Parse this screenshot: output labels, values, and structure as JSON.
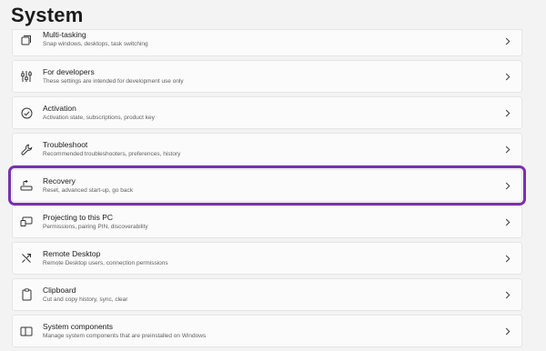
{
  "page": {
    "title": "System"
  },
  "items": [
    {
      "key": "multitasking",
      "title": "Multi-tasking",
      "desc": "Snap windows, desktops, task switching",
      "icon": "multitasking-icon"
    },
    {
      "key": "developers",
      "title": "For developers",
      "desc": "These settings are intended for development use only",
      "icon": "developer-tools-icon"
    },
    {
      "key": "activation",
      "title": "Activation",
      "desc": "Activation state, subscriptions, product key",
      "icon": "activation-check-icon"
    },
    {
      "key": "troubleshoot",
      "title": "Troubleshoot",
      "desc": "Recommended troubleshooters, preferences, history",
      "icon": "wrench-icon"
    },
    {
      "key": "recovery",
      "title": "Recovery",
      "desc": "Reset, advanced start-up, go back",
      "icon": "recovery-icon"
    },
    {
      "key": "projecting",
      "title": "Projecting to this PC",
      "desc": "Permissions, pairing PIN, discoverability",
      "icon": "projecting-icon"
    },
    {
      "key": "remote-desktop",
      "title": "Remote Desktop",
      "desc": "Remote Desktop users, connection permissions",
      "icon": "remote-desktop-icon"
    },
    {
      "key": "clipboard",
      "title": "Clipboard",
      "desc": "Cut and copy history, sync, clear",
      "icon": "clipboard-icon"
    },
    {
      "key": "system-components",
      "title": "System components",
      "desc": "Manage system components that are preinstalled on Windows",
      "icon": "system-components-icon"
    }
  ],
  "highlight": {
    "selected_item": "recovery",
    "color": "#7b2fb0"
  }
}
